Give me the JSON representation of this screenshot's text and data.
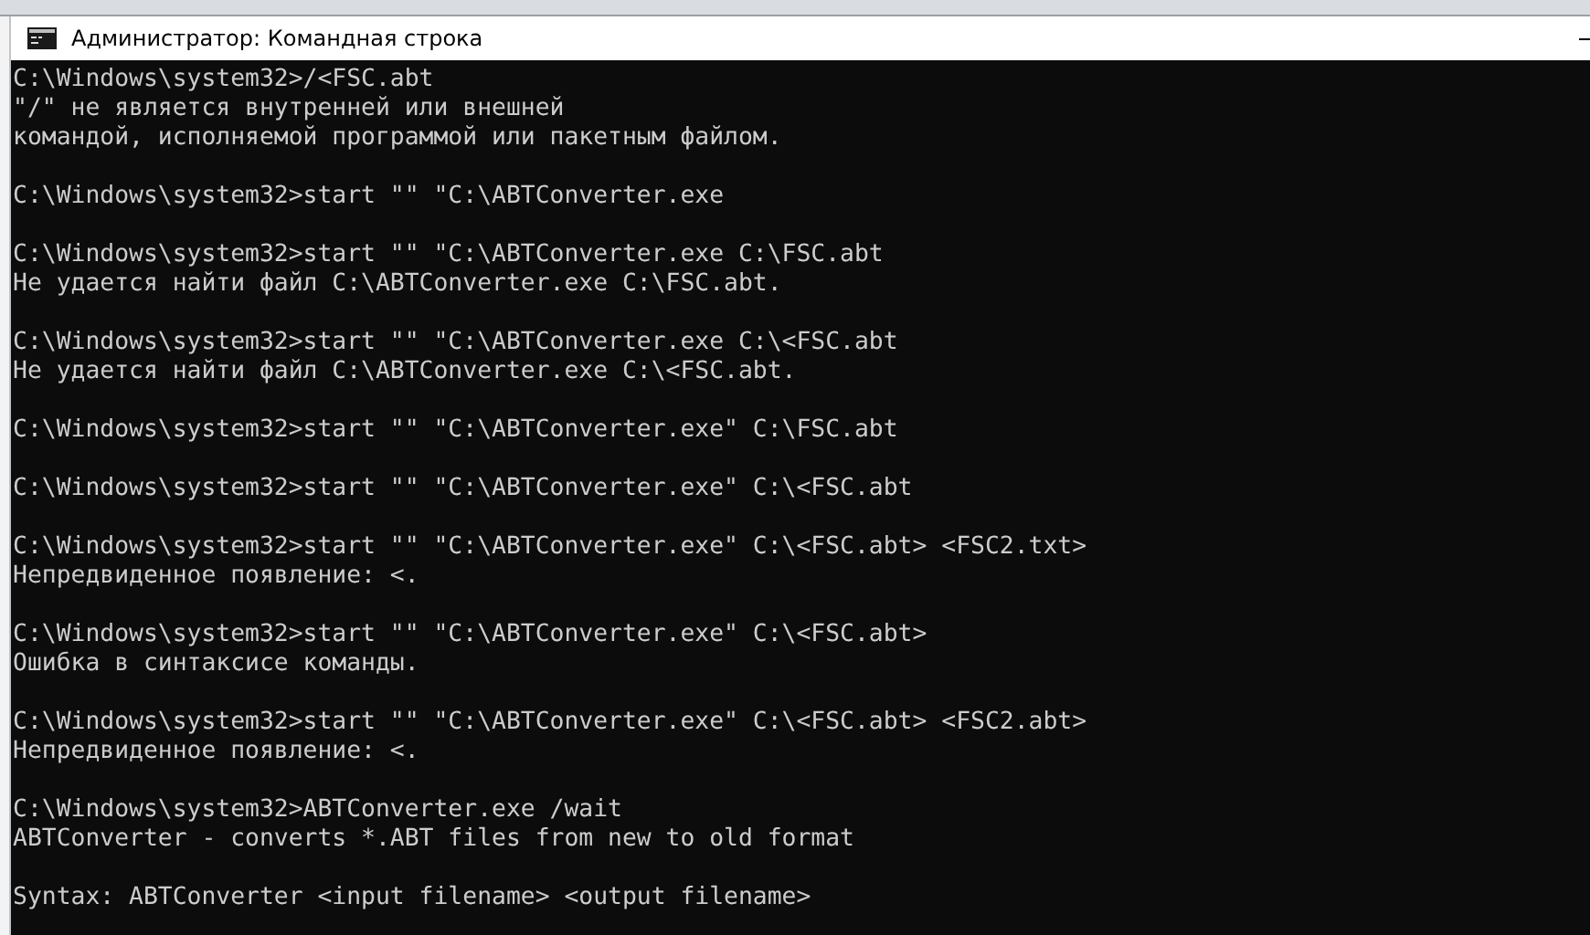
{
  "window": {
    "title": "Администратор: Командная строка"
  },
  "console": {
    "blocks": [
      [
        "C:\\Windows\\system32>/<FSC.abt",
        "\"/\" не является внутренней или внешней",
        "командой, исполняемой программой или пакетным файлом."
      ],
      [
        "C:\\Windows\\system32>start \"\" \"C:\\ABTConverter.exe"
      ],
      [
        "C:\\Windows\\system32>start \"\" \"C:\\ABTConverter.exe C:\\FSC.abt",
        "Не удается найти файл C:\\ABTConverter.exe C:\\FSC.abt."
      ],
      [
        "C:\\Windows\\system32>start \"\" \"C:\\ABTConverter.exe C:\\<FSC.abt",
        "Не удается найти файл C:\\ABTConverter.exe C:\\<FSC.abt."
      ],
      [
        "C:\\Windows\\system32>start \"\" \"C:\\ABTConverter.exe\" C:\\FSC.abt"
      ],
      [
        "C:\\Windows\\system32>start \"\" \"C:\\ABTConverter.exe\" C:\\<FSC.abt"
      ],
      [
        "C:\\Windows\\system32>start \"\" \"C:\\ABTConverter.exe\" C:\\<FSC.abt> <FSC2.txt>",
        "Непредвиденное появление: <."
      ],
      [
        "C:\\Windows\\system32>start \"\" \"C:\\ABTConverter.exe\" C:\\<FSC.abt>",
        "Ошибка в синтаксисе команды."
      ],
      [
        "C:\\Windows\\system32>start \"\" \"C:\\ABTConverter.exe\" C:\\<FSC.abt> <FSC2.abt>",
        "Непредвиденное появление: <."
      ],
      [
        "C:\\Windows\\system32>ABTConverter.exe /wait",
        "ABTConverter - converts *.ABT files from new to old format"
      ],
      [
        "Syntax: ABTConverter <input filename> <output filename>"
      ]
    ]
  }
}
